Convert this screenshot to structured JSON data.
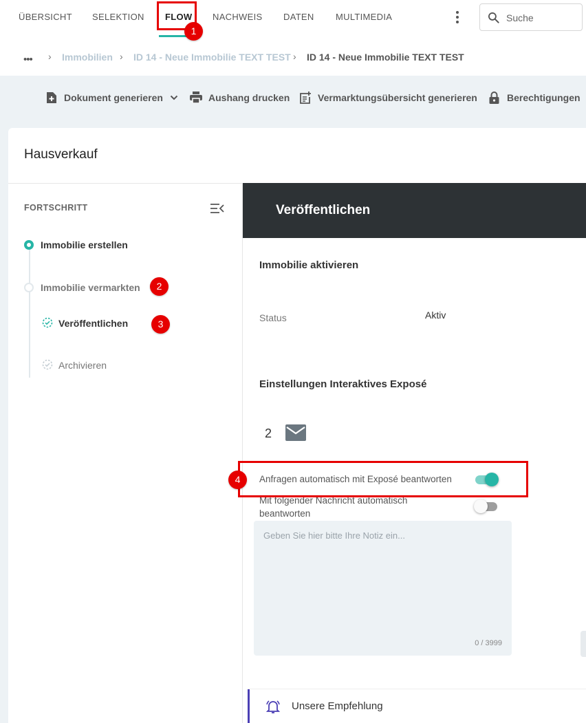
{
  "nav": {
    "items": [
      {
        "label": "ÜBERSICHT"
      },
      {
        "label": "SELEKTION"
      },
      {
        "label": "FLOW"
      },
      {
        "label": "NACHWEIS"
      },
      {
        "label": "DATEN"
      },
      {
        "label": "MULTIMEDIA"
      }
    ],
    "active": "FLOW",
    "search_placeholder": "Suche"
  },
  "breadcrumb": {
    "items": [
      {
        "label": "Immobilien"
      },
      {
        "label": "ID 14 - Neue Immobilie TEXT TEST"
      }
    ],
    "current": "ID 14 - Neue Immobilie TEXT TEST"
  },
  "actions": [
    {
      "label": "Dokument generieren",
      "icon": "add-document-icon"
    },
    {
      "label": "Aushang drucken",
      "icon": "print-icon"
    },
    {
      "label": "Vermarktungsübersicht generieren",
      "icon": "post-add-icon"
    },
    {
      "label": "Berechtigungen",
      "icon": "lock-icon"
    }
  ],
  "card": {
    "title": "Hausverkauf"
  },
  "progress": {
    "title": "FORTSCHRITT",
    "steps": [
      {
        "label": "Immobilie erstellen",
        "state": "current"
      },
      {
        "label": "Immobilie vermarkten",
        "state": "pending"
      },
      {
        "label": "Veröffentlichen",
        "state": "active-substep"
      },
      {
        "label": "Archivieren",
        "state": "pending-substep"
      }
    ]
  },
  "content": {
    "header": "Veröffentlichen",
    "activate_title": "Immobilie aktivieren",
    "status_label": "Status",
    "status_value": "Aktiv",
    "expose_title": "Einstellungen Interaktives Exposé",
    "mail_count": "2",
    "toggle1": {
      "label": "Anfragen automatisch mit Exposé beantworten",
      "on": true
    },
    "toggle2": {
      "label": "Mit folgender Nachricht automatisch beantworten",
      "on": false
    },
    "notes_placeholder": "Geben Sie hier bitte Ihre Notiz ein...",
    "notes_counter": "0 / 3999",
    "recommendation": "Unsere Empfehlung"
  },
  "annotations": [
    "1",
    "2",
    "3",
    "4"
  ],
  "colors": {
    "accent": "#26b5a6",
    "dark_header": "#2d3235",
    "highlight": "#e60000",
    "recommend_bar": "#4b3fb5"
  }
}
